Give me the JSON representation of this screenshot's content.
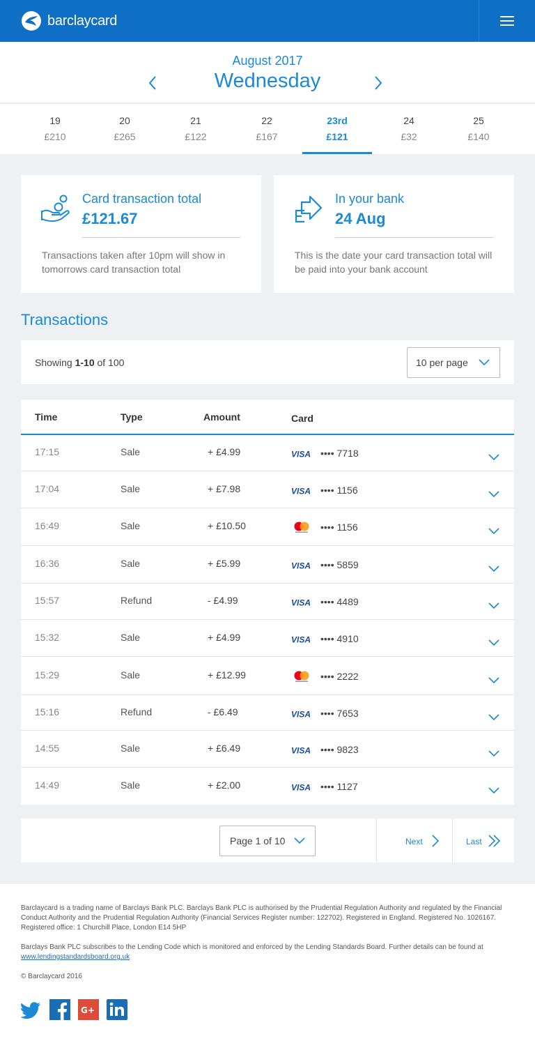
{
  "header": {
    "brand": "barclaycard",
    "colors": {
      "primary": "#0e6fc4",
      "accent": "#1a8ad7"
    }
  },
  "date_nav": {
    "month": "August 2017",
    "weekday": "Wednesday",
    "days": [
      {
        "num": "19",
        "amount": "£210"
      },
      {
        "num": "20",
        "amount": "£265"
      },
      {
        "num": "21",
        "amount": "£122"
      },
      {
        "num": "22",
        "amount": "£167"
      },
      {
        "num": "23rd",
        "amount": "£121",
        "active": true
      },
      {
        "num": "24",
        "amount": "£32"
      },
      {
        "num": "25",
        "amount": "£140"
      }
    ]
  },
  "summary": {
    "total": {
      "icon": "hand-coins-icon",
      "title": "Card transaction total",
      "value": "£121.67",
      "note": "Transactions taken after 10pm will show in tomorrows card transaction total"
    },
    "bank": {
      "icon": "transfer-arrow-icon",
      "title": "In your bank",
      "value": "24 Aug",
      "note": "This is the date your card transaction total will be paid into your bank account"
    }
  },
  "transactions": {
    "title": "Transactions",
    "showing_prefix": "Showing",
    "showing_range": "1-10",
    "showing_suffix": "of 100",
    "per_page": "10 per page",
    "columns": {
      "time": "Time",
      "type": "Type",
      "amount": "Amount",
      "card": "Card"
    },
    "rows": [
      {
        "time": "17:15",
        "type": "Sale",
        "amount": "+ £4.99",
        "brand": "visa",
        "card": "•••• 7718"
      },
      {
        "time": "17:04",
        "type": "Sale",
        "amount": "+ £7.98",
        "brand": "visa",
        "card": "•••• 1156"
      },
      {
        "time": "16:49",
        "type": "Sale",
        "amount": "+ £10.50",
        "brand": "mastercard",
        "card": "•••• 1156"
      },
      {
        "time": "16:36",
        "type": "Sale",
        "amount": "+ £5.99",
        "brand": "visa",
        "card": "•••• 5859"
      },
      {
        "time": "15:57",
        "type": "Refund",
        "amount": "- £4.99",
        "brand": "visa",
        "card": "•••• 4489"
      },
      {
        "time": "15:32",
        "type": "Sale",
        "amount": "+ £4.99",
        "brand": "visa",
        "card": "•••• 4910"
      },
      {
        "time": "15:29",
        "type": "Sale",
        "amount": "+ £12.99",
        "brand": "mastercard",
        "card": "•••• 2222"
      },
      {
        "time": "15:16",
        "type": "Refund",
        "amount": "- £6.49",
        "brand": "visa",
        "card": "•••• 7653"
      },
      {
        "time": "14:55",
        "type": "Sale",
        "amount": "+ £6.49",
        "brand": "visa",
        "card": "•••• 9823"
      },
      {
        "time": "14:49",
        "type": "Sale",
        "amount": "+ £2.00",
        "brand": "visa",
        "card": "•••• 1127"
      }
    ]
  },
  "pagination": {
    "page_label": "Page 1 of 10",
    "next": "Next",
    "last": "Last"
  },
  "footer": {
    "legal1": "Barclaycard is a trading name of Barclays Bank PLC. Barclays Bank PLC is authorised by the Prudential Regulation Authority and regulated by the Financial Conduct Authority and the Prudential Regulation Authority (Financial Services Register number: 122702). Registered in England. Registered No. 1026167. Registered office: 1 Churchill Place, London E14 5HP",
    "legal2": "Barclays Bank PLC subscribes to the Lending Code which is monitored and enforced by the Lending Standards Board. Further details can be found at",
    "link": "www.lendingstandardsboard.org.uk",
    "copyright": "© Barclaycard 2016",
    "social": [
      "twitter-icon",
      "facebook-icon",
      "google-plus-icon",
      "linkedin-icon"
    ]
  }
}
